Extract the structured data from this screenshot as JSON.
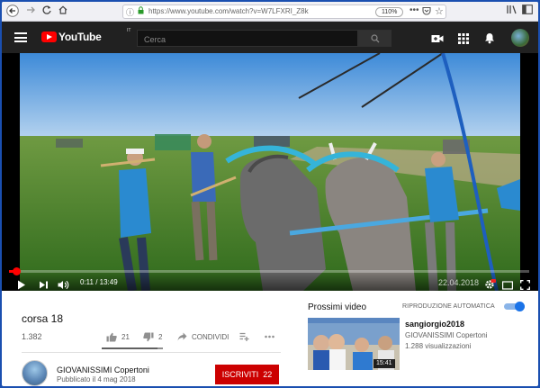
{
  "browser": {
    "url": "https://www.youtube.com/watch?v=W7LFXRI_Z8k",
    "zoom": "110%",
    "more": "•••"
  },
  "header": {
    "logo_text": "YouTube",
    "logo_region": "IT",
    "search_placeholder": "Cerca"
  },
  "player": {
    "time_current": "0:11",
    "time_total": "13:49",
    "time_display": "0:11 / 13:49",
    "progress_fraction": 0.0133,
    "watermark": "22.04.2018",
    "hd_badge": "HD"
  },
  "video": {
    "title": "corsa 18",
    "views": "1.382",
    "likes": "21",
    "dislikes": "2",
    "share_label": "CONDIVIDI",
    "like_ratio": 0.913
  },
  "channel": {
    "name": "GIOVANISSIMI Copertoni",
    "published": "Pubblicato il 4 mag 2018",
    "subscribe_label": "ISCRIVITI",
    "subscriber_count": "22"
  },
  "sidebar": {
    "up_next_label": "Prossimi video",
    "autoplay_label": "RIPRODUZIONE AUTOMATICA",
    "autoplay_on": true,
    "items": [
      {
        "title": "sangiorgio2018",
        "channel": "GIOVANISSIMI Copertoni",
        "views": "1.288 visualizzazioni",
        "duration": "15:41"
      }
    ]
  },
  "colors": {
    "youtube_red": "#ff0000",
    "subscribe_red": "#cc0000",
    "header_dark": "#212121",
    "toggle_blue": "#1a73e8"
  }
}
